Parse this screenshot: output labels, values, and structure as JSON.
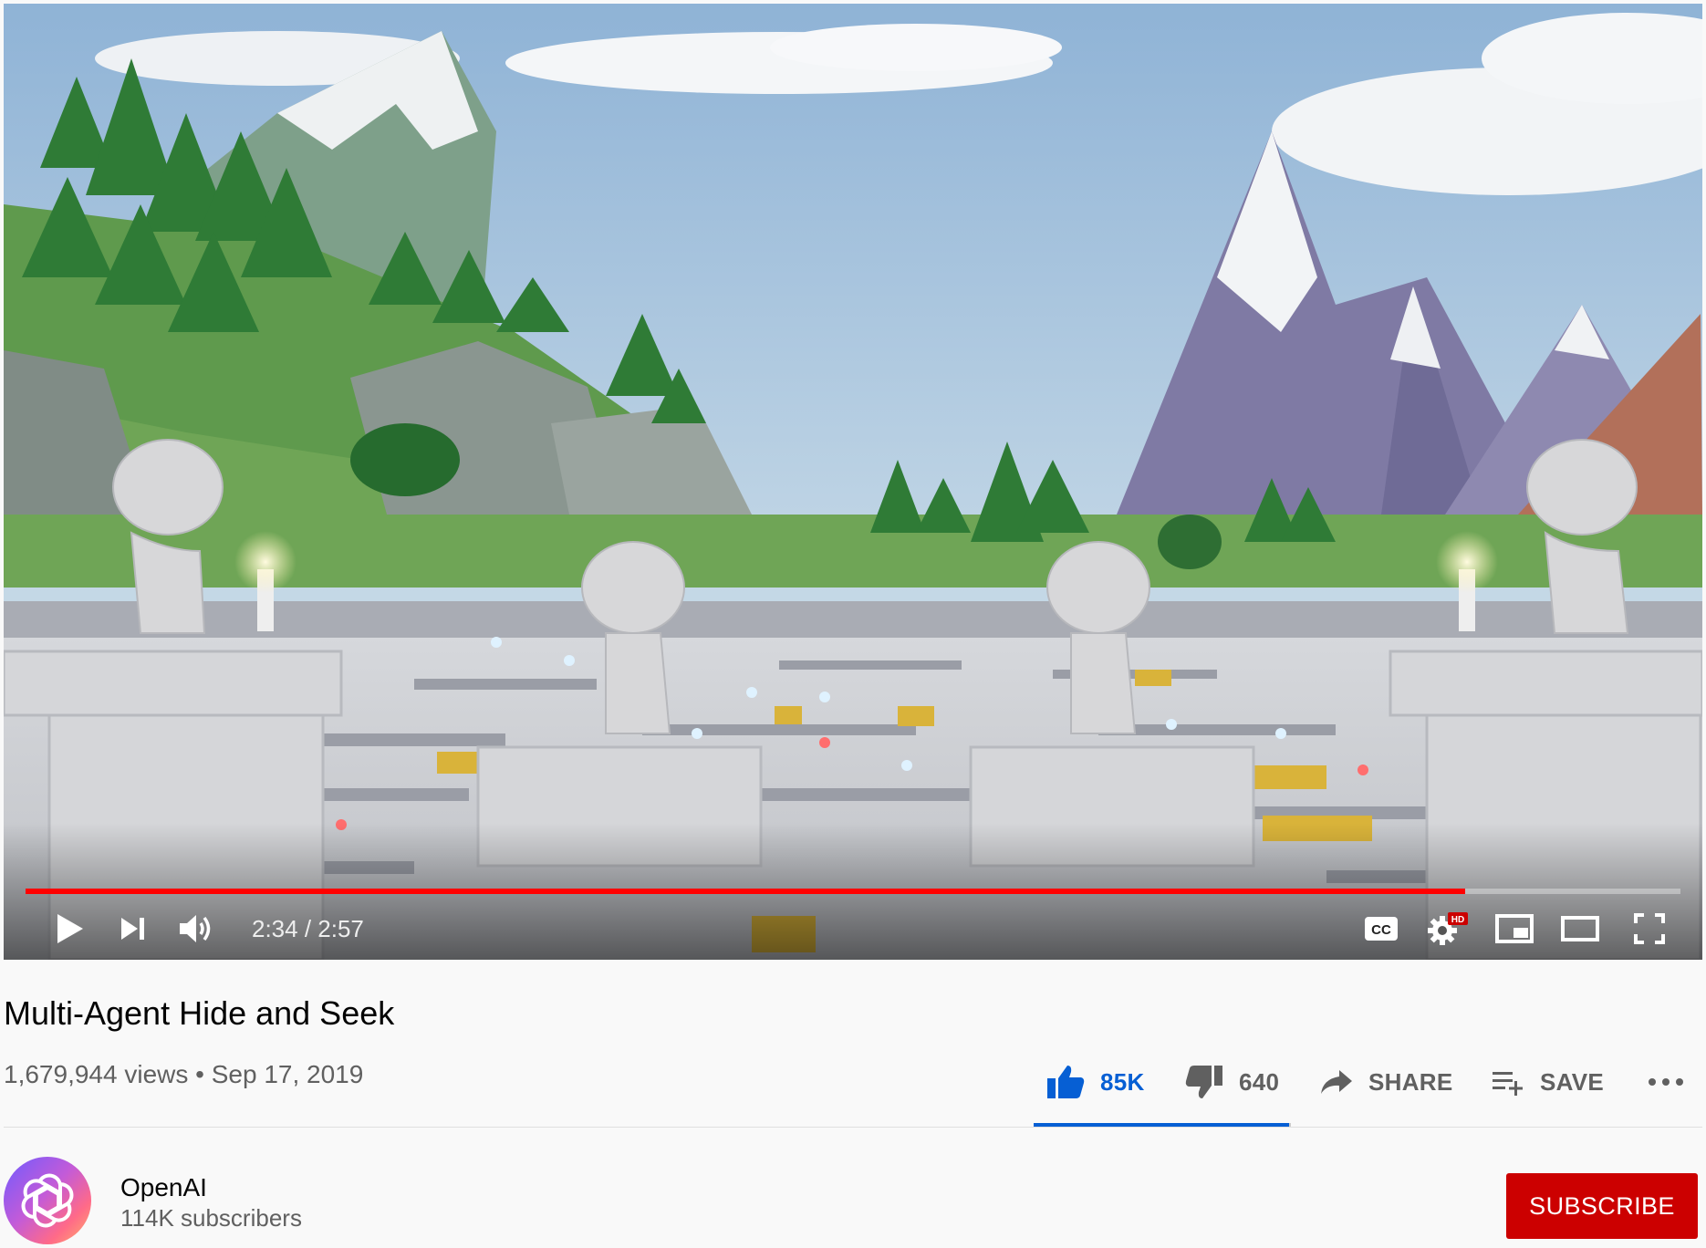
{
  "player": {
    "current_time": "2:34",
    "duration": "2:57",
    "time_display": "2:34 / 2:57",
    "progress_fraction": 0.87,
    "hd_badge": "HD",
    "cc_label": "CC",
    "icons": {
      "play": "play-icon",
      "next": "next-icon",
      "volume": "volume-icon",
      "captions": "captions-icon",
      "settings": "settings-gear-icon",
      "miniplayer": "miniplayer-icon",
      "theater": "theater-mode-icon",
      "fullscreen": "fullscreen-icon"
    }
  },
  "video": {
    "title": "Multi-Agent Hide and Seek",
    "views": "1,679,944 views",
    "separator": "•",
    "date": "Sep 17, 2019"
  },
  "actions": {
    "like_count": "85K",
    "dislike_count": "640",
    "share_label": "SHARE",
    "save_label": "SAVE",
    "like_ratio": 0.9925,
    "icons": {
      "like": "thumbs-up-icon",
      "dislike": "thumbs-down-icon",
      "share": "share-arrow-icon",
      "save": "playlist-add-icon",
      "more": "more-horizontal-icon"
    }
  },
  "channel": {
    "name": "OpenAI",
    "subscribers": "114K subscribers",
    "avatar_icon": "openai-logo-icon"
  },
  "subscribe_label": "SUBSCRIBE",
  "colors": {
    "progress_played": "#ff0000",
    "like_active": "#065fd4",
    "subscribe_bg": "#cc0000",
    "secondary_text": "#606060"
  }
}
